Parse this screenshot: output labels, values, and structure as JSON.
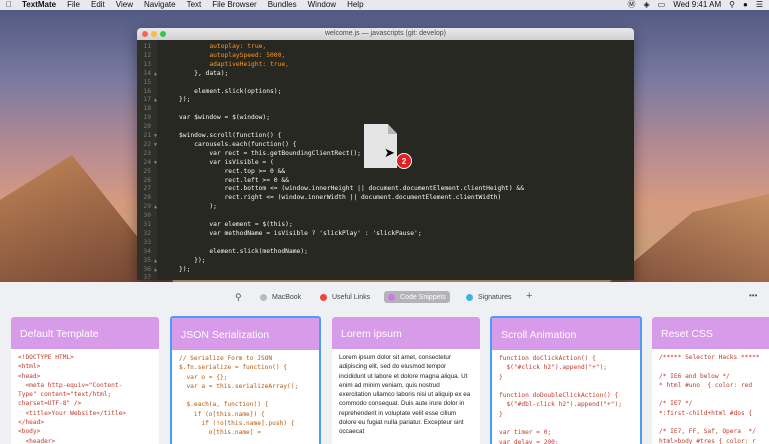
{
  "menubar": {
    "app": "TextMate",
    "items": [
      "File",
      "Edit",
      "View",
      "Navigate",
      "Text",
      "File Browser",
      "Bundles",
      "Window",
      "Help"
    ],
    "clock": "Wed 9:41 AM"
  },
  "editor": {
    "title": "welcome.js — javascripts (git: develop)",
    "lines": [
      {
        "n": "11",
        "f": "",
        "t": "        autoplay: true,"
      },
      {
        "n": "12",
        "f": "",
        "t": "        autoplaySpeed: 5000,"
      },
      {
        "n": "13",
        "f": "",
        "t": "        adaptiveHeight: true,"
      },
      {
        "n": "14",
        "f": "▲",
        "t": "    }, data);"
      },
      {
        "n": "15",
        "f": "",
        "t": ""
      },
      {
        "n": "16",
        "f": "",
        "t": "    element.slick(options);"
      },
      {
        "n": "17",
        "f": "▲",
        "t": "});"
      },
      {
        "n": "18",
        "f": "",
        "t": ""
      },
      {
        "n": "19",
        "f": "",
        "t": "var $window = $(window);"
      },
      {
        "n": "20",
        "f": "",
        "t": ""
      },
      {
        "n": "21",
        "f": "▼",
        "t": "$window.scroll(function() {"
      },
      {
        "n": "22",
        "f": "▼",
        "t": "    carousels.each(function() {"
      },
      {
        "n": "23",
        "f": "",
        "t": "        var rect = this.getBoundingClientRect();"
      },
      {
        "n": "24",
        "f": "▼",
        "t": "        var isVisible = ("
      },
      {
        "n": "25",
        "f": "",
        "t": "            rect.top >= 0 &&"
      },
      {
        "n": "26",
        "f": "",
        "t": "            rect.left >= 0 &&"
      },
      {
        "n": "27",
        "f": "",
        "t": "            rect.bottom <= (window.innerHeight || document.documentElement.clientHeight) &&"
      },
      {
        "n": "28",
        "f": "",
        "t": "            rect.right <= (window.innerWidth || document.documentElement.clientWidth)"
      },
      {
        "n": "29",
        "f": "▲",
        "t": "        );"
      },
      {
        "n": "30",
        "f": "",
        "t": ""
      },
      {
        "n": "31",
        "f": "",
        "t": "        var element = $(this);"
      },
      {
        "n": "32",
        "f": "",
        "t": "        var methodName = isVisible ? 'slickPlay' : 'slickPause';"
      },
      {
        "n": "33",
        "f": "",
        "t": ""
      },
      {
        "n": "34",
        "f": "",
        "t": "        element.slick(methodName);"
      },
      {
        "n": "35",
        "f": "▲",
        "t": "    });"
      },
      {
        "n": "36",
        "f": "▲",
        "t": "});"
      },
      {
        "n": "37",
        "f": "",
        "t": ""
      },
      {
        "n": "38",
        "f": "",
        "t": "$window.scroll();"
      }
    ],
    "drag_badge": "2"
  },
  "shelf": {
    "tags": [
      {
        "label": "MacBook",
        "color": "#b9b9bd",
        "selected": false
      },
      {
        "label": "Useful Links",
        "color": "#f0443a",
        "selected": false
      },
      {
        "label": "Code Snippets",
        "color": "#c77ee0",
        "selected": true
      },
      {
        "label": "Signatures",
        "color": "#3fb2e5",
        "selected": false
      }
    ],
    "cards": [
      {
        "title": "Default Template",
        "body": "<!DOCTYPE HTML>\n<html>\n<head>\n  <meta http-equiv=\"Content-\nType\" content=\"text/html;\ncharset=UTF-8\" />\n  <title>Your Website</title>\n</head>\n<body>\n  <header>"
      },
      {
        "title": "JSON Serialization",
        "body": "// Serialize Form to JSON\n$.fn.serialize = function() {\n  var o = {};\n  var a = this.serializeArray();\n\n  $.each(a, function() {\n    if (o[this.name]) {\n      if (!o[this.name].push) {\n        o[this.name] ="
      },
      {
        "title": "Lorem ipsum",
        "body": "Lorem ipsum dolor sit amet, consectetur adipiscing elit, sed do eiusmod tempor incididunt ut labore et dolore magna aliqua. Ut enim ad minim veniam, quis nostrud exercitation ullamco laboris nisi ut aliquip ex ea commodo consequat. Duis aute irure dolor in reprehenderit in voluptate velit esse cillum dolore eu fugiat nulla pariatur. Excepteur sint occaecat"
      },
      {
        "title": "Scroll Animation",
        "body": "function doClickAction() {\n  $(\"#click h2\").append(\"+\");\n}\n\nfunction doDoubleClickAction() {\n  $(\"#dbl-click h2\").append(\"+\");\n}\n\nvar timer = 0;\nvar delay = 200;"
      },
      {
        "title": "Reset CSS",
        "body": "/***** Selector Hacks *****\n\n/* IE6 and below */\n* html #uno  { color: red\n\n/* IE7 */\n*:first-child+html #dos {\n\n/* IE7, FF, Saf, Opera  */\nhtml>body #tres { color: r"
      }
    ]
  }
}
